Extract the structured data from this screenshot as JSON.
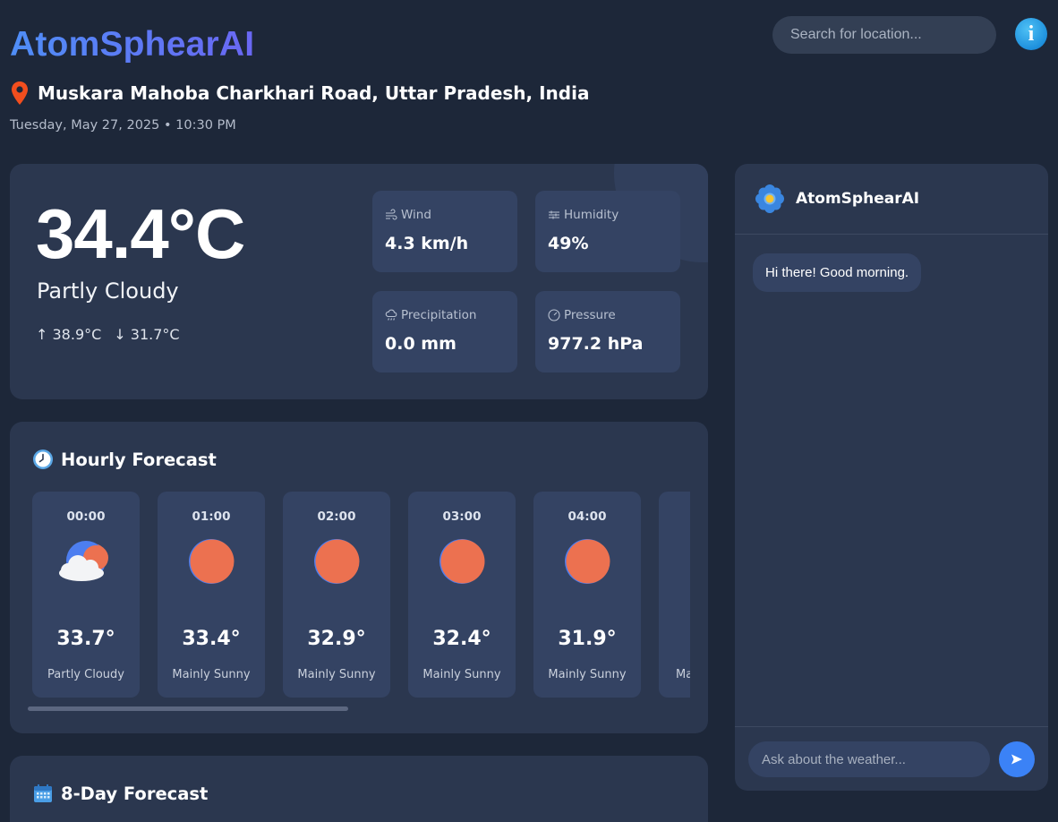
{
  "header": {
    "brand": "AtomSphearAI",
    "location": "Muskara Mahoba Charkhari Road, Uttar Pradesh, India",
    "datetime": "Tuesday, May 27, 2025 • 10:30 PM",
    "search_placeholder": "Search for location...",
    "info_icon": "info-icon"
  },
  "current": {
    "temperature": "34.4°C",
    "condition": "Partly Cloudy",
    "high": "↑ 38.9°C",
    "low": "↓ 31.7°C",
    "stats": [
      {
        "label": "Wind",
        "value": "4.3 km/h",
        "icon": "wind-icon"
      },
      {
        "label": "Humidity",
        "value": "49%",
        "icon": "humidity-icon"
      },
      {
        "label": "Precipitation",
        "value": "0.0 mm",
        "icon": "rain-cloud-icon"
      },
      {
        "label": "Pressure",
        "value": "977.2 hPa",
        "icon": "gauge-icon"
      }
    ]
  },
  "hourly": {
    "title": "Hourly Forecast",
    "items": [
      {
        "time": "00:00",
        "temp": "33.7°",
        "condition": "Partly Cloudy",
        "icon": "partly-cloudy-icon"
      },
      {
        "time": "01:00",
        "temp": "33.4°",
        "condition": "Mainly Sunny",
        "icon": "sun-icon"
      },
      {
        "time": "02:00",
        "temp": "32.9°",
        "condition": "Mainly Sunny",
        "icon": "sun-icon"
      },
      {
        "time": "03:00",
        "temp": "32.4°",
        "condition": "Mainly Sunny",
        "icon": "sun-icon"
      },
      {
        "time": "04:00",
        "temp": "31.9°",
        "condition": "Mainly Sunny",
        "icon": "sun-icon"
      },
      {
        "time": "",
        "temp": "",
        "condition": "Ma",
        "icon": ""
      }
    ]
  },
  "daily": {
    "title": "8-Day Forecast"
  },
  "chat": {
    "title": "AtomSphearAI",
    "messages": [
      {
        "from": "bot",
        "text": "Hi there! Good morning."
      }
    ],
    "input_placeholder": "Ask about the weather...",
    "send_icon": "send-icon"
  },
  "colors": {
    "background": "#1d2739",
    "card": "#2b374f",
    "tile": "#344363",
    "accent": "#3b82f6",
    "brand_start": "#4f8ef7",
    "brand_end": "#6a67f3",
    "sun": "#ec7150",
    "pin": "#f24e1e"
  }
}
